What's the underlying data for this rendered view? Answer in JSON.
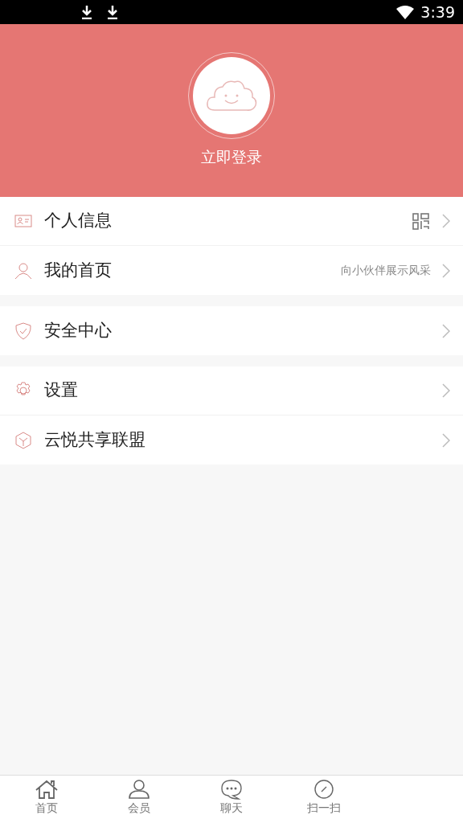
{
  "status_bar": {
    "time": "3:39"
  },
  "profile": {
    "login_label": "立即登录"
  },
  "menu_groups": [
    {
      "items": [
        {
          "label": "个人信息",
          "kind": "qr"
        },
        {
          "label": "我的首页",
          "kind": "hint",
          "hint": "向小伙伴展示风采"
        }
      ]
    },
    {
      "items": [
        {
          "label": "安全中心",
          "kind": "plain"
        }
      ]
    },
    {
      "items": [
        {
          "label": "设置",
          "kind": "plain"
        },
        {
          "label": "云悦共享联盟",
          "kind": "plain"
        }
      ]
    }
  ],
  "bottom_nav": [
    {
      "label": "首页"
    },
    {
      "label": "会员"
    },
    {
      "label": "聊天"
    },
    {
      "label": "扫一扫"
    }
  ]
}
